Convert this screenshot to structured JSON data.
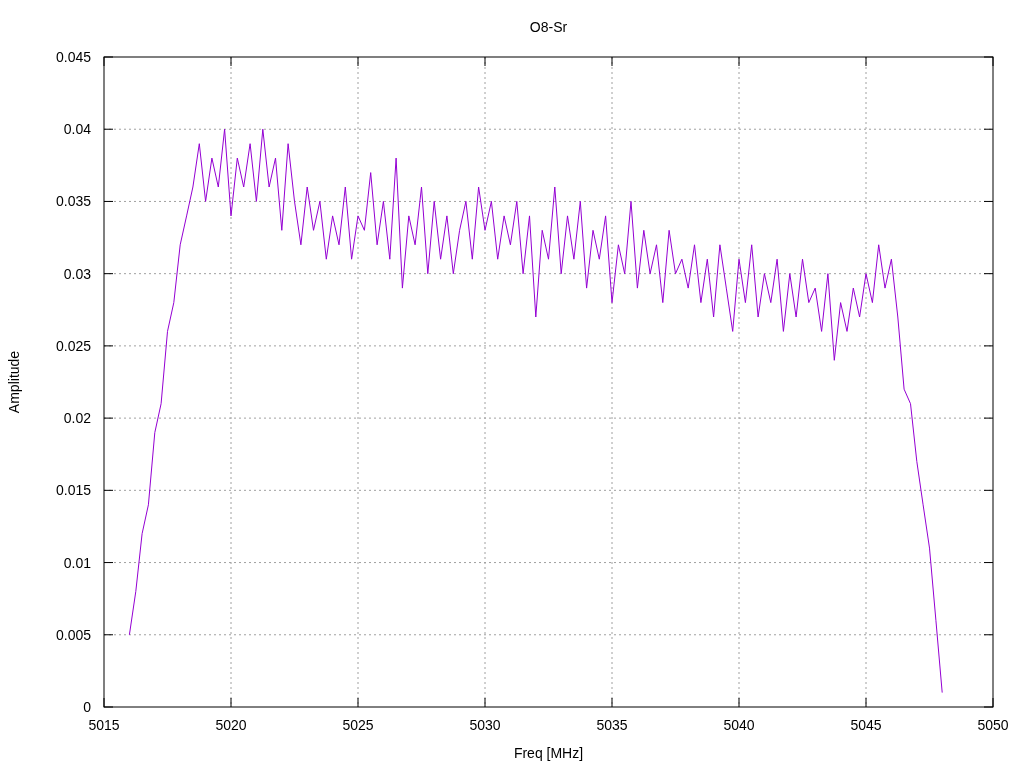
{
  "chart": {
    "chart_data": {
      "type": "line",
      "title": "O8-Sr",
      "xlabel": "Freq [MHz]",
      "ylabel": "Amplitude",
      "grid": true,
      "xlim": [
        5015,
        5050
      ],
      "ylim": [
        0,
        0.045
      ],
      "xticks": [
        5015,
        5020,
        5025,
        5030,
        5035,
        5040,
        5045,
        5050
      ],
      "yticks": [
        0,
        0.005,
        0.01,
        0.015,
        0.02,
        0.025,
        0.03,
        0.035,
        0.04,
        0.045
      ],
      "x": [
        5016,
        5016.25,
        5016.5,
        5016.75,
        5017,
        5017.25,
        5017.5,
        5017.75,
        5018,
        5018.25,
        5018.5,
        5018.75,
        5019,
        5019.25,
        5019.5,
        5019.75,
        5020,
        5020.25,
        5020.5,
        5020.75,
        5021,
        5021.25,
        5021.5,
        5021.75,
        5022,
        5022.25,
        5022.5,
        5022.75,
        5023,
        5023.25,
        5023.5,
        5023.75,
        5024,
        5024.25,
        5024.5,
        5024.75,
        5025,
        5025.25,
        5025.5,
        5025.75,
        5026,
        5026.25,
        5026.5,
        5026.75,
        5027,
        5027.25,
        5027.5,
        5027.75,
        5028,
        5028.25,
        5028.5,
        5028.75,
        5029,
        5029.25,
        5029.5,
        5029.75,
        5030,
        5030.25,
        5030.5,
        5030.75,
        5031,
        5031.25,
        5031.5,
        5031.75,
        5032,
        5032.25,
        5032.5,
        5032.75,
        5033,
        5033.25,
        5033.5,
        5033.75,
        5034,
        5034.25,
        5034.5,
        5034.75,
        5035,
        5035.25,
        5035.5,
        5035.75,
        5036,
        5036.25,
        5036.5,
        5036.75,
        5037,
        5037.25,
        5037.5,
        5037.75,
        5038,
        5038.25,
        5038.5,
        5038.75,
        5039,
        5039.25,
        5039.5,
        5039.75,
        5040,
        5040.25,
        5040.5,
        5040.75,
        5041,
        5041.25,
        5041.5,
        5041.75,
        5042,
        5042.25,
        5042.5,
        5042.75,
        5043,
        5043.25,
        5043.5,
        5043.75,
        5044,
        5044.25,
        5044.5,
        5044.75,
        5045,
        5045.25,
        5045.5,
        5045.75,
        5046,
        5046.25,
        5046.5,
        5046.75,
        5047,
        5047.25,
        5047.5,
        5047.75,
        5048
      ],
      "series": [
        {
          "color": "#9400d3",
          "values": [
            0.005,
            0.008,
            0.012,
            0.014,
            0.019,
            0.021,
            0.026,
            0.028,
            0.032,
            0.034,
            0.036,
            0.039,
            0.035,
            0.038,
            0.036,
            0.04,
            0.034,
            0.038,
            0.036,
            0.039,
            0.035,
            0.04,
            0.036,
            0.038,
            0.033,
            0.039,
            0.035,
            0.032,
            0.036,
            0.033,
            0.035,
            0.031,
            0.034,
            0.032,
            0.036,
            0.031,
            0.034,
            0.033,
            0.037,
            0.032,
            0.035,
            0.031,
            0.038,
            0.029,
            0.034,
            0.032,
            0.036,
            0.03,
            0.035,
            0.031,
            0.034,
            0.03,
            0.033,
            0.035,
            0.031,
            0.036,
            0.033,
            0.035,
            0.031,
            0.034,
            0.032,
            0.035,
            0.03,
            0.034,
            0.027,
            0.033,
            0.031,
            0.036,
            0.03,
            0.034,
            0.031,
            0.035,
            0.029,
            0.033,
            0.031,
            0.034,
            0.028,
            0.032,
            0.03,
            0.035,
            0.029,
            0.033,
            0.03,
            0.032,
            0.028,
            0.033,
            0.03,
            0.031,
            0.029,
            0.032,
            0.028,
            0.031,
            0.027,
            0.032,
            0.029,
            0.026,
            0.031,
            0.028,
            0.032,
            0.027,
            0.03,
            0.028,
            0.031,
            0.026,
            0.03,
            0.027,
            0.031,
            0.028,
            0.029,
            0.026,
            0.03,
            0.024,
            0.028,
            0.026,
            0.029,
            0.027,
            0.03,
            0.028,
            0.032,
            0.029,
            0.031,
            0.027,
            0.022,
            0.021,
            0.017,
            0.014,
            0.011,
            0.006,
            0.001
          ]
        }
      ]
    }
  }
}
